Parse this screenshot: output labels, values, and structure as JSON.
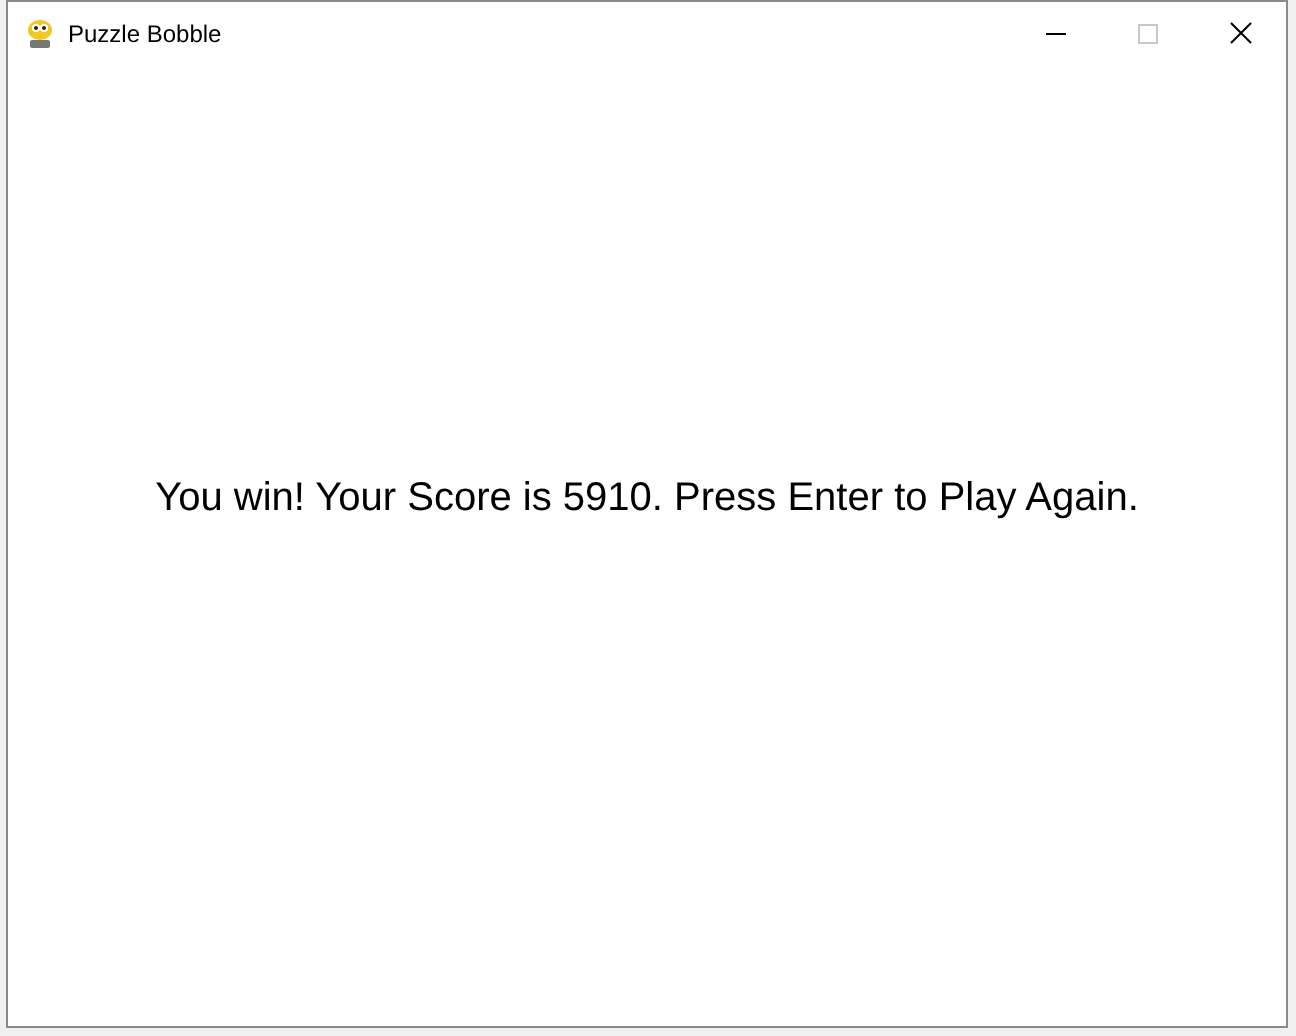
{
  "window": {
    "title": "Puzzle Bobble",
    "controls": [
      {
        "kind": "minimize",
        "disabled": false
      },
      {
        "kind": "maximize",
        "disabled": true
      },
      {
        "kind": "close",
        "disabled": false
      }
    ]
  },
  "message": "You win! Your Score is 5910. Press Enter to Play Again."
}
